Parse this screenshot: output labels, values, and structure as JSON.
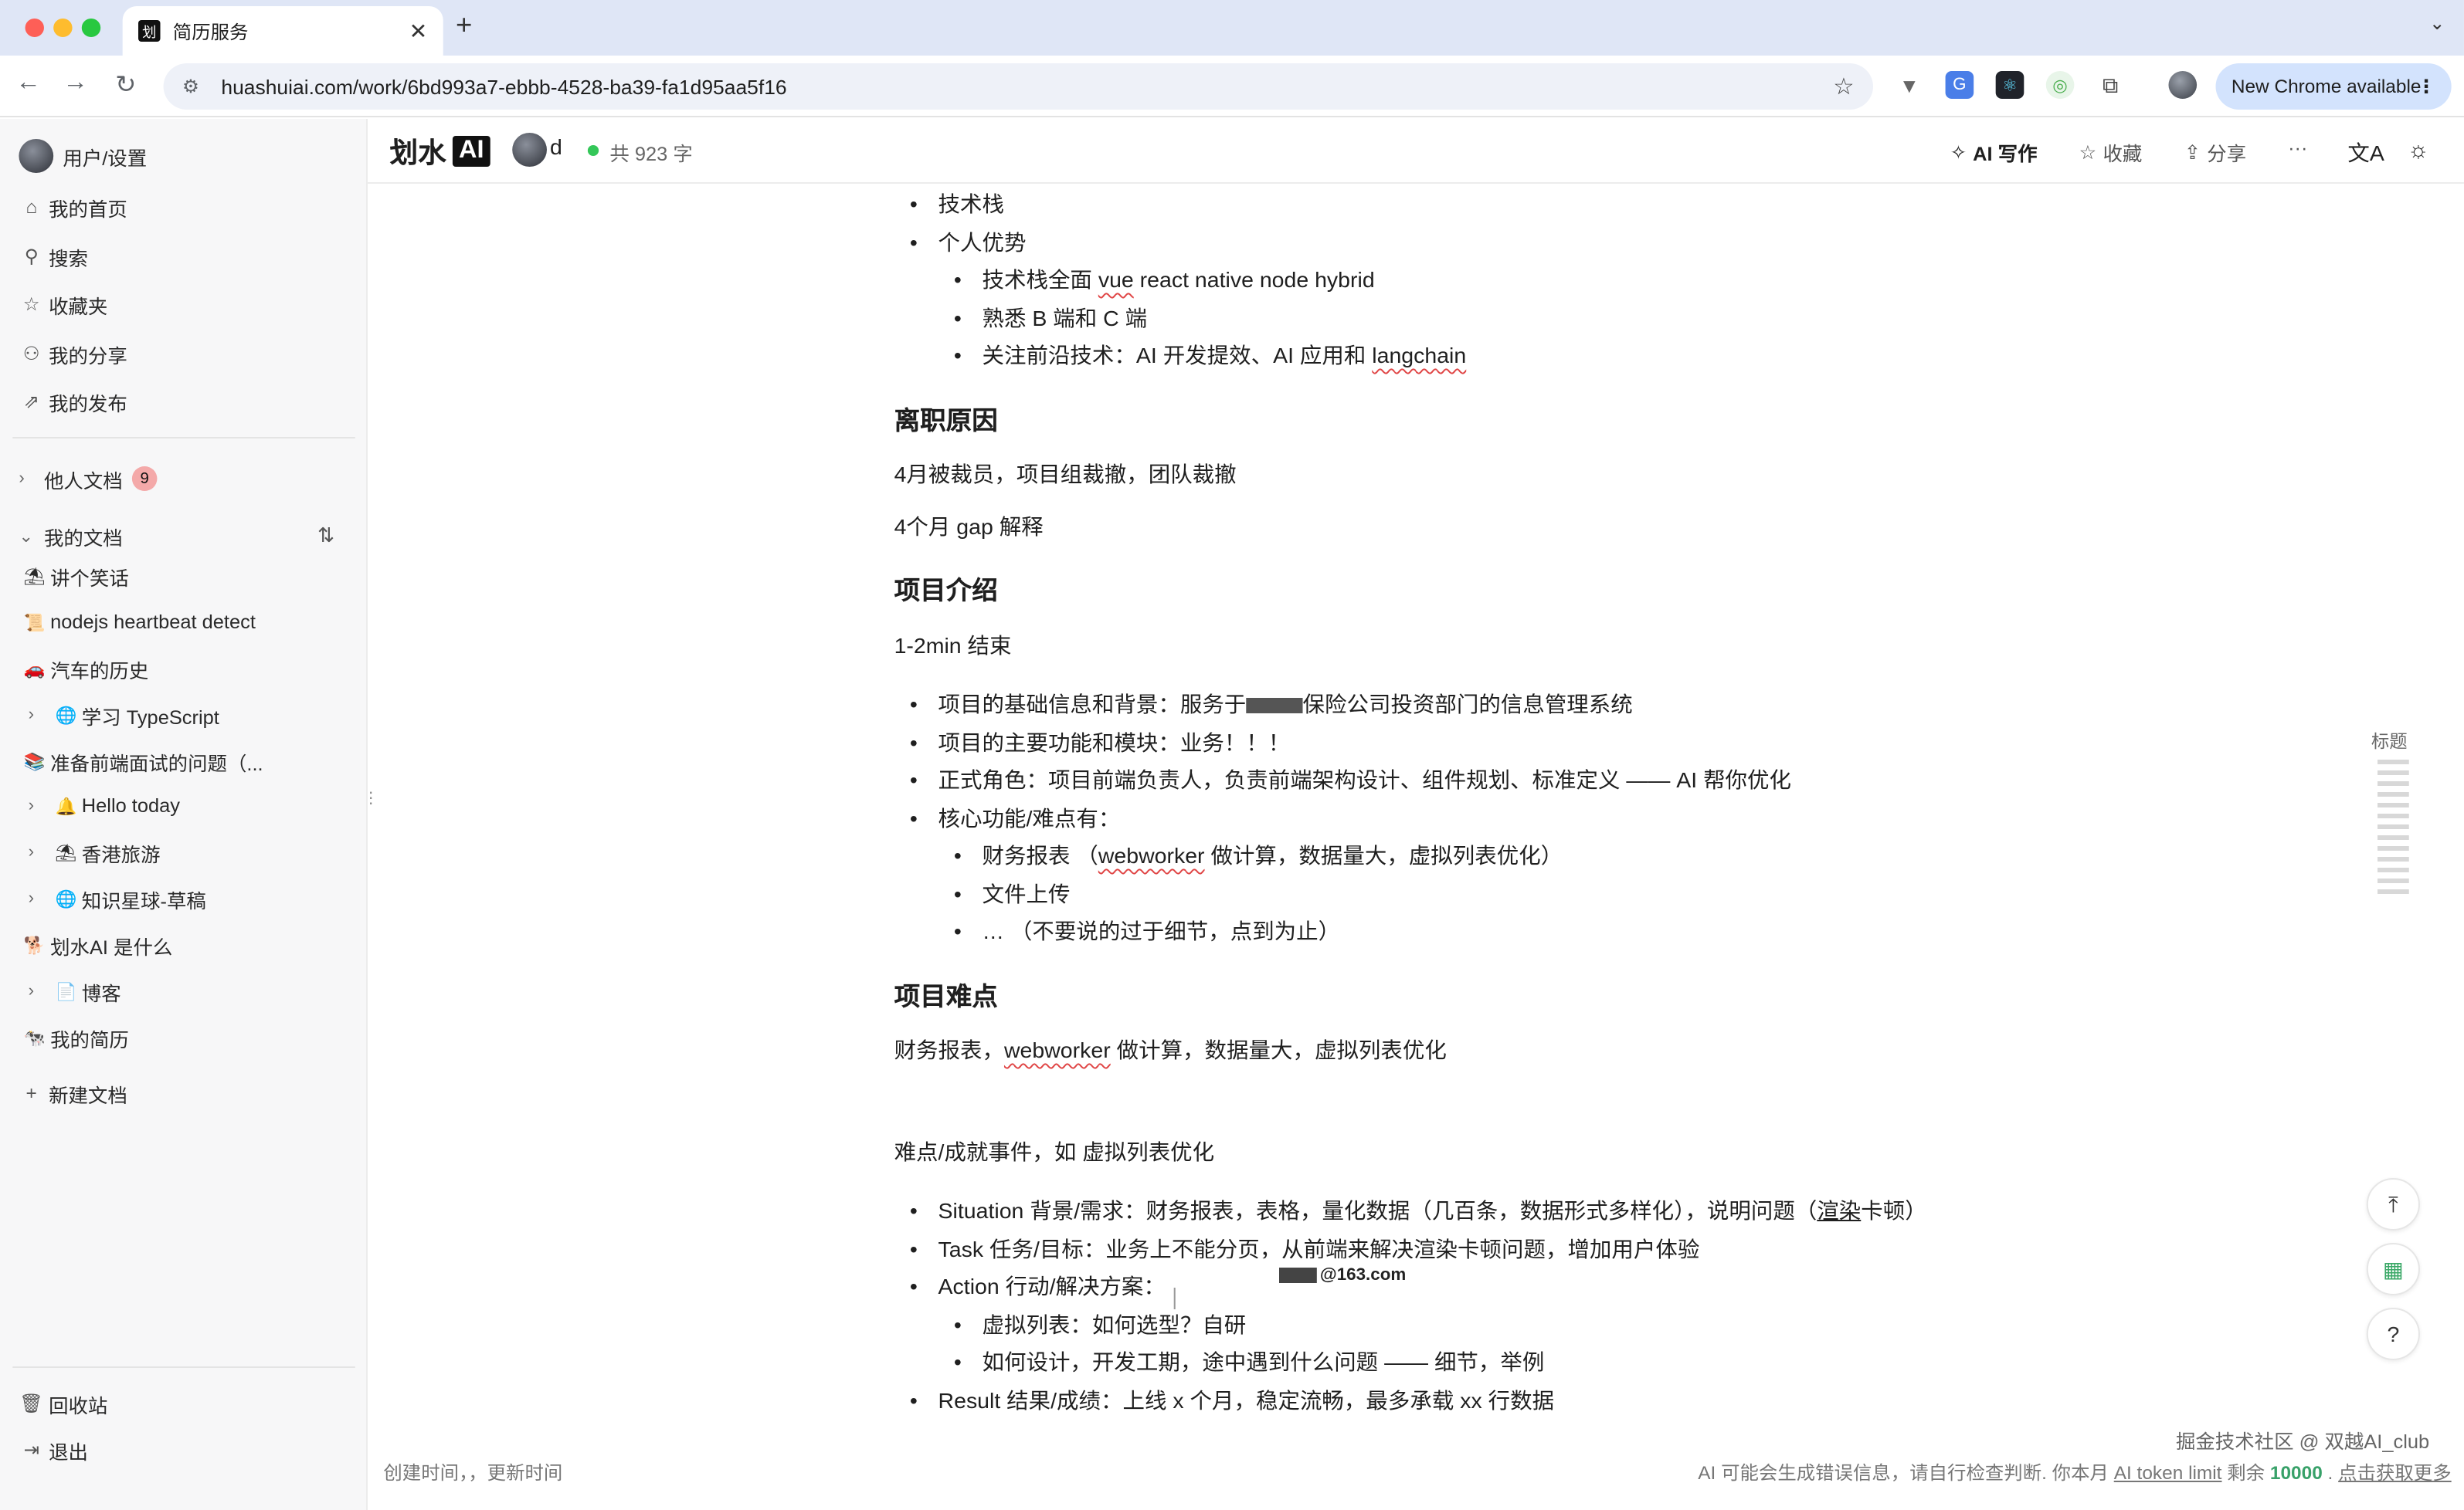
{
  "browser": {
    "tab_title": "简历服务",
    "tab_favicon": "划",
    "url": "huashuiai.com/work/6bd993a7-ebbb-4528-ba39-fa1d95aa5f16",
    "new_chrome_label": "New Chrome available"
  },
  "sidebar": {
    "user_settings": "用户/设置",
    "nav": [
      {
        "label": "我的首页",
        "icon": "home-icon"
      },
      {
        "label": "搜索",
        "icon": "search-icon"
      },
      {
        "label": "收藏夹",
        "icon": "star-icon"
      },
      {
        "label": "我的分享",
        "icon": "users-icon"
      },
      {
        "label": "我的发布",
        "icon": "external-link-icon"
      }
    ],
    "others_docs": "他人文档",
    "others_badge": "9",
    "my_docs": "我的文档",
    "docs": [
      {
        "emoji": "⛱",
        "label": "讲个笑话"
      },
      {
        "emoji": "📜",
        "label": "nodejs heartbeat detect"
      },
      {
        "emoji": "🚗",
        "label": "汽车的历史"
      },
      {
        "emoji": "🌐",
        "label": "学习 TypeScript"
      },
      {
        "emoji": "📚",
        "label": "准备前端面试的问题（..."
      },
      {
        "emoji": "🔔",
        "label": "Hello today"
      },
      {
        "emoji": "⛱",
        "label": "香港旅游"
      },
      {
        "emoji": "🌐",
        "label": "知识星球-草稿"
      },
      {
        "emoji": "🐕",
        "label": "划水AI 是什么"
      },
      {
        "emoji": "📄",
        "label": "博客"
      },
      {
        "emoji": "🐄",
        "label": "我的简历"
      }
    ],
    "new_doc": "新建文档",
    "trash": "回收站",
    "logout": "退出"
  },
  "header": {
    "logo_text": "划水",
    "logo_ai": "AI",
    "user": "d",
    "word_count": "共 923 字",
    "ai_write": "AI 写作",
    "favorite": "收藏",
    "share": "分享",
    "more": "···"
  },
  "doc": {
    "top_items": [
      "技术栈",
      "个人优势"
    ],
    "advantages": [
      "技术栈全面 ",
      "vue",
      " react native node hybrid",
      "熟悉 B 端和 C 端",
      "关注前沿技术：AI 开发提效、AI 应用和 ",
      "langchain"
    ],
    "h_leave": "离职原因",
    "leave_p1": "4月被裁员，项目组裁撤，团队裁撤",
    "leave_p2": "4个月 gap 解释",
    "h_project": "项目介绍",
    "project_p": "1-2min 结束",
    "project_items": [
      "项目的基础信息和背景：服务于",
      "保险公司投资部门的信息管理系统",
      "项目的主要功能和模块：业务！！！",
      "正式角色：项目前端负责人，负责前端架构设计、组件规划、标准定义 —— AI 帮你优化",
      "核心功能/难点有："
    ],
    "core_items": [
      "财务报表 （",
      "webworker",
      " 做计算，数据量大，虚拟列表优化）",
      "文件上传",
      "… （不要说的过于细节，点到为止）"
    ],
    "h_difficulty": "项目难点",
    "diff_p_a": "财务报表，",
    "diff_p_b": "webworker",
    "diff_p_c": " 做计算，数据量大，虚拟列表优化",
    "diff_p2": "难点/成就事件，如 虚拟列表优化",
    "star_items": [
      "Situation 背景/需求：财务报表，表格，量化数据（几百条，数据形式多样化），说明问题（",
      "渲染",
      "卡顿）",
      "Task 任务/目标：业务上不能分页，从前端来解决渲染卡顿问题，增加用户体验",
      "Action 行动/解决方案："
    ],
    "action_items": [
      "虚拟列表：如何选型？自研",
      "如何设计，开发工期，途中遇到什么问题 —— 细节，举例"
    ],
    "result": "Result 结果/成绩：上线 x 个月，稳定流畅，最多承载 xx 行数据",
    "email_suffix": "@163.com"
  },
  "toc_label": "标题",
  "footer": {
    "left": "创建时间，，更新时间",
    "right_a": "AI 可能会生成错误信息，请自行检查判断. 你本月 ",
    "right_link": "AI token limit",
    "right_b": " 剩余 ",
    "right_num": "10000",
    "right_c": " . ",
    "right_link2": "点击获取更多"
  },
  "watermark": "掘金技术社区 @ 双越AI_club"
}
